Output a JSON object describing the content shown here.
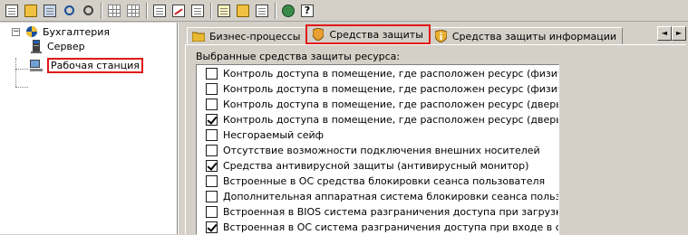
{
  "toolbar": {
    "icons": [
      "new-document-icon",
      "open-folder-icon",
      "save-icon",
      "search-icon",
      "zoom-icon",
      "grid-icon",
      "table-icon",
      "copy-icon",
      "edit-icon",
      "list-icon",
      "folder-icon",
      "report-icon",
      "network-icon",
      "help-icon"
    ],
    "help_glyph": "?"
  },
  "tree": {
    "root": {
      "label": "Бухгалтерия",
      "expander": "−"
    },
    "children": [
      {
        "label": "Сервер"
      },
      {
        "label": "Рабочая станция"
      }
    ]
  },
  "tabs": [
    {
      "label": "Бизнес-процессы"
    },
    {
      "label": "Средства защиты"
    },
    {
      "label": "Средства защиты информации"
    }
  ],
  "tab_scroll": {
    "left": "◄",
    "right": "►"
  },
  "panel": {
    "title": "Выбранные средства защиты ресурса:",
    "items": [
      {
        "label": "Контроль доступа в помещение, где расположен ресурс (физическая охра",
        "checked": false
      },
      {
        "label": "Контроль доступа в помещение, где расположен ресурс (физическая охра",
        "checked": false
      },
      {
        "label": "Контроль доступа в помещение, где расположен ресурс (дверь с замком,",
        "checked": false
      },
      {
        "label": "Контроль доступа в помещение, где расположен ресурс (дверь с замком)",
        "checked": true
      },
      {
        "label": "Несгораемый сейф",
        "checked": false
      },
      {
        "label": "Отсутствие возможности подключения внешних носителей",
        "checked": false
      },
      {
        "label": "Средства антивирусной защиты (антивирусный монитор)",
        "checked": true
      },
      {
        "label": "Встроенные в ОС средства блокировки сеанса пользователя",
        "checked": false
      },
      {
        "label": "Дополнительная аппаратная система блокировки сеанса пользователя",
        "checked": false
      },
      {
        "label": "Встроенная в BIOS система разграничения доступа при загрузке",
        "checked": false
      },
      {
        "label": "Встроенная в ОС система разграничения доступа при входе в систему",
        "checked": true
      }
    ]
  },
  "colors": {
    "highlight": "#e01818",
    "chrome": "#d4d0c8"
  }
}
